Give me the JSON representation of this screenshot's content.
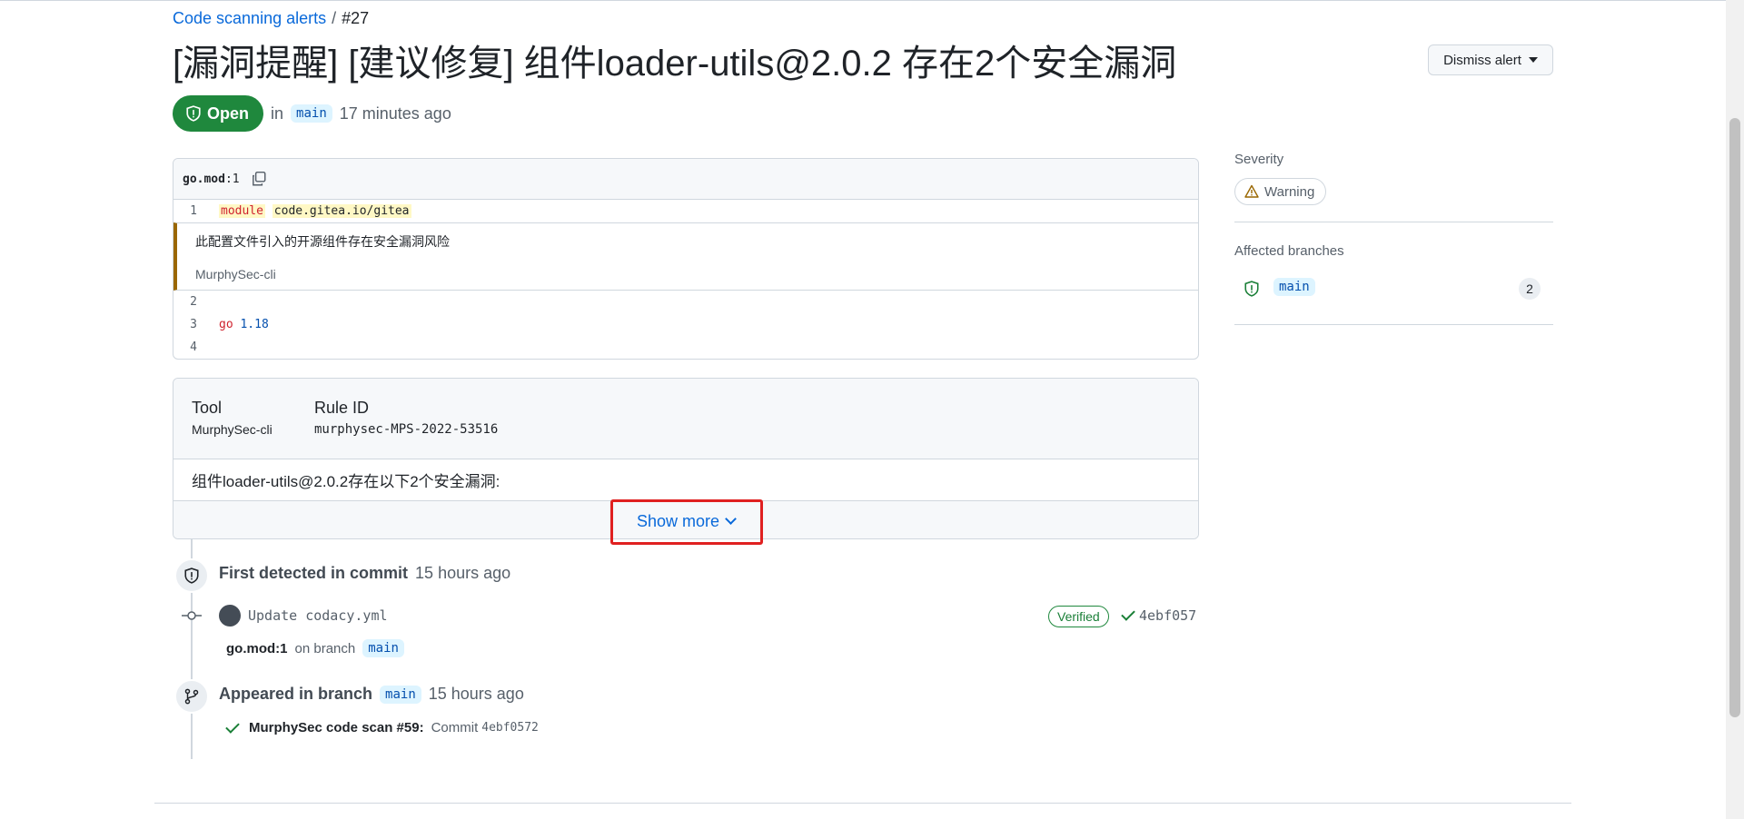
{
  "breadcrumb": {
    "parent": "Code scanning alerts",
    "separator": "/",
    "current": "#27"
  },
  "title": "[漏洞提醒] [建议修复] 组件loader-utils@2.0.2 存在2个安全漏洞",
  "dismiss_button": "Dismiss alert",
  "status": {
    "label": "Open",
    "in_label": "in",
    "branch": "main",
    "time": "17 minutes ago"
  },
  "code": {
    "file": "go.mod",
    "line_ref": ":1",
    "lines": [
      {
        "num": "1",
        "keyword": "module",
        "text": "code.gitea.io/gitea"
      },
      {
        "num": "2",
        "text": ""
      },
      {
        "num": "3",
        "keyword": "go",
        "text": "1.18"
      },
      {
        "num": "4",
        "text": ""
      }
    ],
    "annotation": {
      "message": "此配置文件引入的开源组件存在安全漏洞风险",
      "tool": "MurphySec-cli"
    }
  },
  "rule": {
    "tool_header": "Tool",
    "tool_value": "MurphySec-cli",
    "rule_header": "Rule ID",
    "rule_value": "murphysec-MPS-2022-53516",
    "description": "组件loader-utils@2.0.2存在以下2个安全漏洞:",
    "show_more": "Show more"
  },
  "timeline": {
    "first": {
      "label": "First detected in commit",
      "time": "15 hours ago"
    },
    "commit": {
      "message": "Update codacy.yml",
      "verified": "Verified",
      "sha": "4ebf057"
    },
    "location": {
      "file": "go.mod:1",
      "on_branch": "on branch",
      "branch": "main"
    },
    "appeared": {
      "label": "Appeared in branch",
      "branch": "main",
      "time": "15 hours ago"
    },
    "scan": {
      "name": "MurphySec code scan #59:",
      "commit_label": "Commit",
      "sha": "4ebf0572"
    }
  },
  "sidebar": {
    "severity_label": "Severity",
    "severity_value": "Warning",
    "affected_label": "Affected branches",
    "branch": "main",
    "branch_count": "2"
  },
  "colors": {
    "open_green": "#1f883d",
    "link_blue": "#0969da",
    "warning": "#9a6700",
    "highlight_red": "#e02020"
  },
  "icons": [
    "shield-icon",
    "copy-icon",
    "warning-icon",
    "commit-icon",
    "branch-icon",
    "check-icon",
    "chevron-down-icon"
  ]
}
